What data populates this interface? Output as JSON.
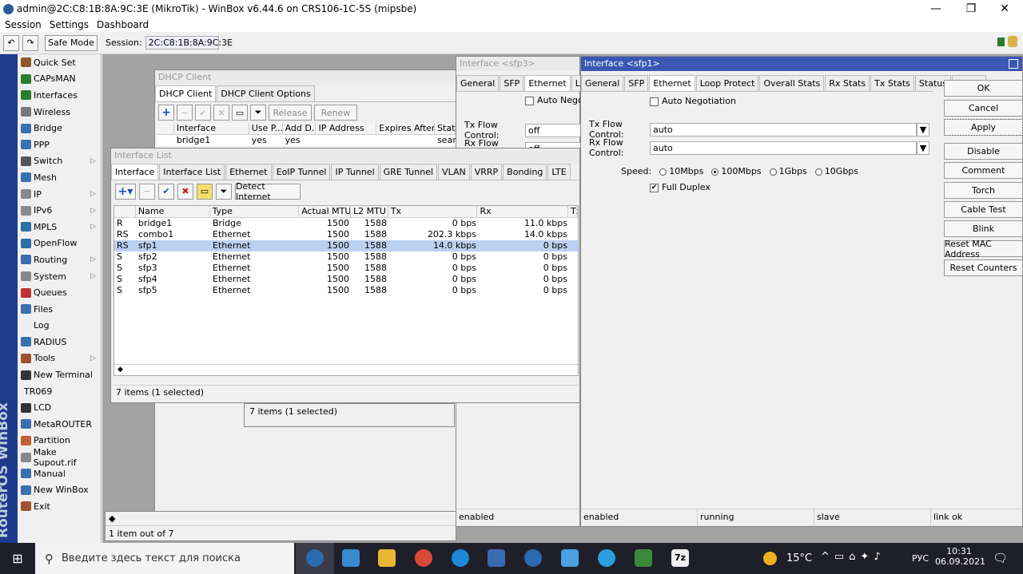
{
  "app": {
    "title": "admin@2C:C8:1B:8A:9C:3E (MikroTik) - WinBox v6.44.6 on CRS106-1C-5S (mipsbe)"
  },
  "menu": [
    "Session",
    "Settings",
    "Dashboard"
  ],
  "toolbar": {
    "safe_mode": "Safe Mode",
    "session_label": "Session:",
    "session_value": "2C:C8:1B:8A:9C:3E"
  },
  "brand": "RouterOS WinBox",
  "sidebar": {
    "items": [
      {
        "label": "Quick Set",
        "icon": "quickset-icon",
        "color": "#8a5a2b",
        "arrow": false
      },
      {
        "label": "CAPsMAN",
        "icon": "capsman-icon",
        "color": "#2d7d2d",
        "arrow": false
      },
      {
        "label": "Interfaces",
        "icon": "interfaces-icon",
        "color": "#2d7d2d",
        "arrow": false
      },
      {
        "label": "Wireless",
        "icon": "wireless-icon",
        "color": "#777777",
        "arrow": false
      },
      {
        "label": "Bridge",
        "icon": "bridge-icon",
        "color": "#3a6fb0",
        "arrow": false
      },
      {
        "label": "PPP",
        "icon": "ppp-icon",
        "color": "#3a6fb0",
        "arrow": false
      },
      {
        "label": "Switch",
        "icon": "switch-icon",
        "color": "#555555",
        "arrow": true
      },
      {
        "label": "Mesh",
        "icon": "mesh-icon",
        "color": "#3a6fb0",
        "arrow": false
      },
      {
        "label": "IP",
        "icon": "ip-icon",
        "color": "#888888",
        "arrow": true
      },
      {
        "label": "IPv6",
        "icon": "ipv6-icon",
        "color": "#888888",
        "arrow": true
      },
      {
        "label": "MPLS",
        "icon": "mpls-icon",
        "color": "#2a6fa8",
        "arrow": true
      },
      {
        "label": "OpenFlow",
        "icon": "openflow-icon",
        "color": "#2a6fa8",
        "arrow": false
      },
      {
        "label": "Routing",
        "icon": "routing-icon",
        "color": "#3a6fb0",
        "arrow": true
      },
      {
        "label": "System",
        "icon": "system-icon",
        "color": "#888888",
        "arrow": true
      },
      {
        "label": "Queues",
        "icon": "queues-icon",
        "color": "#c03030",
        "arrow": false
      },
      {
        "label": "Files",
        "icon": "files-icon",
        "color": "#3a6fb0",
        "arrow": false
      },
      {
        "label": "Log",
        "icon": "log-icon",
        "color": "#eeeeee",
        "arrow": false
      },
      {
        "label": "RADIUS",
        "icon": "radius-icon",
        "color": "#3a6fb0",
        "arrow": false
      },
      {
        "label": "Tools",
        "icon": "tools-icon",
        "color": "#a05030",
        "arrow": true
      },
      {
        "label": "New Terminal",
        "icon": "terminal-icon",
        "color": "#333333",
        "arrow": false
      },
      {
        "label": "TR069",
        "icon": "",
        "color": "",
        "arrow": false
      },
      {
        "label": "LCD",
        "icon": "lcd-icon",
        "color": "#333333",
        "arrow": false
      },
      {
        "label": "MetaROUTER",
        "icon": "metarouter-icon",
        "color": "#3a6fb0",
        "arrow": false
      },
      {
        "label": "Partition",
        "icon": "partition-icon",
        "color": "#c06030",
        "arrow": false
      },
      {
        "label": "Make Supout.rif",
        "icon": "supout-icon",
        "color": "#888888",
        "arrow": false
      },
      {
        "label": "Manual",
        "icon": "manual-icon",
        "color": "#3a6fb0",
        "arrow": false
      },
      {
        "label": "New WinBox",
        "icon": "winbox-icon",
        "color": "#3a6fb0",
        "arrow": false
      },
      {
        "label": "Exit",
        "icon": "exit-icon",
        "color": "#a05030",
        "arrow": false
      }
    ]
  },
  "dhcp": {
    "title": "DHCP Client",
    "tabs": [
      "DHCP Client",
      "DHCP Client Options"
    ],
    "release": "Release",
    "renew": "Renew",
    "cols": [
      "Interface",
      "Use P...",
      "Add D...",
      "IP Address",
      "Expires After",
      "Statu"
    ],
    "row": [
      "bridge1",
      "yes",
      "yes",
      "",
      "",
      "searc"
    ],
    "status_left": "1 item out of 7"
  },
  "iflist": {
    "title": "Interface List",
    "tabs": [
      "Interface",
      "Interface List",
      "Ethernet",
      "EoIP Tunnel",
      "IP Tunnel",
      "GRE Tunnel",
      "VLAN",
      "VRRP",
      "Bonding",
      "LTE"
    ],
    "detect": "Detect Internet",
    "cols": [
      "Name",
      "Type",
      "Actual MTU",
      "L2 MTU",
      "Tx",
      "Rx",
      "Tx"
    ],
    "rows": [
      {
        "flag": "R",
        "name": "bridge1",
        "type": "Bridge",
        "mtu": "1500",
        "l2": "1588",
        "tx": "0 bps",
        "rx": "11.0 kbps",
        "sel": false
      },
      {
        "flag": "RS",
        "name": "combo1",
        "type": "Ethernet",
        "mtu": "1500",
        "l2": "1588",
        "tx": "202.3 kbps",
        "rx": "14.0 kbps",
        "sel": false
      },
      {
        "flag": "RS",
        "name": "sfp1",
        "type": "Ethernet",
        "mtu": "1500",
        "l2": "1588",
        "tx": "14.0 kbps",
        "rx": "0 bps",
        "sel": true
      },
      {
        "flag": "S",
        "name": "sfp2",
        "type": "Ethernet",
        "mtu": "1500",
        "l2": "1588",
        "tx": "0 bps",
        "rx": "0 bps",
        "sel": false
      },
      {
        "flag": "S",
        "name": "sfp3",
        "type": "Ethernet",
        "mtu": "1500",
        "l2": "1588",
        "tx": "0 bps",
        "rx": "0 bps",
        "sel": false
      },
      {
        "flag": "S",
        "name": "sfp4",
        "type": "Ethernet",
        "mtu": "1500",
        "l2": "1588",
        "tx": "0 bps",
        "rx": "0 bps",
        "sel": false
      },
      {
        "flag": "S",
        "name": "sfp5",
        "type": "Ethernet",
        "mtu": "1500",
        "l2": "1588",
        "tx": "0 bps",
        "rx": "0 bps",
        "sel": false
      }
    ],
    "status": "7 items (1 selected)",
    "status_behind": "7 items (1 selected)"
  },
  "sfp3": {
    "title": "Interface <sfp3>",
    "tabs": [
      "General",
      "SFP",
      "Ethernet",
      "Loop"
    ],
    "auto_neg": "Auto Negoti",
    "tx_label": "Tx Flow Control:",
    "tx_value": "off",
    "rx_label": "Rx Flow Control:",
    "rx_value": "off",
    "status": "enabled"
  },
  "sfp1": {
    "title": "Interface <sfp1>",
    "tabs": [
      "General",
      "SFP",
      "Ethernet",
      "Loop Protect",
      "Overall Stats",
      "Rx Stats",
      "Tx Stats",
      "Status",
      "Traffic"
    ],
    "auto_neg": "Auto Negotiation",
    "tx_label": "Tx Flow Control:",
    "tx_value": "auto",
    "rx_label": "Rx Flow Control:",
    "rx_value": "auto",
    "speed_label": "Speed:",
    "speeds": [
      "10Mbps",
      "100Mbps",
      "1Gbps",
      "10Gbps"
    ],
    "speed_selected": "100Mbps",
    "full_duplex": "Full Duplex",
    "buttons": [
      "OK",
      "Cancel",
      "Apply",
      "Disable",
      "Comment",
      "Torch",
      "Cable Test",
      "Blink",
      "Reset MAC Address",
      "Reset Counters"
    ],
    "status": [
      "enabled",
      "running",
      "slave",
      "link ok"
    ]
  },
  "taskbar": {
    "search": "Введите здесь текст для поиска",
    "weather": "15°C",
    "lang": "РУС",
    "time": "10:31",
    "date": "06.09.2021"
  }
}
